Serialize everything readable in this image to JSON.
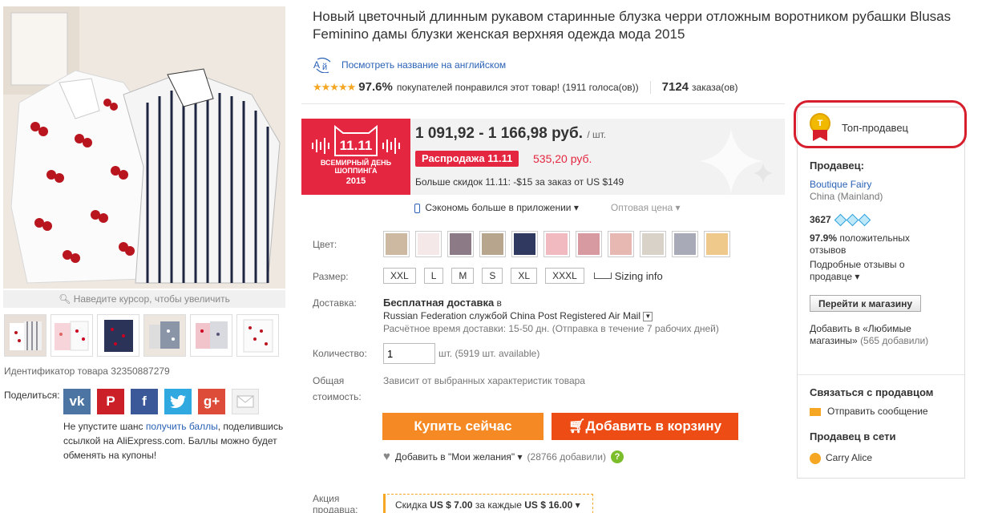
{
  "title": "Новый цветочный длинным рукавом старинные блузка черри отложным воротником рубашки Blusas Feminino дамы блузки женская верхняя одежда мода 2015",
  "translate_link": "Посмотреть название на английском",
  "rating": {
    "percent": "97.6%",
    "text": "покупателей понравился этот товар!",
    "votes": "(1911 голоса(ов))",
    "orders_count": "7124",
    "orders_label": "заказа(ов)"
  },
  "gallery": {
    "zoom_hint": "Наведите курсор, чтобы увеличить",
    "product_id": "Идентификатор товара 32350887279"
  },
  "share": {
    "label": "Поделиться:",
    "text_before": "Не упустите шанс ",
    "link": "получить баллы",
    "text_after": ", поделившись ссылкой на AliExpress.com. Баллы можно будет обменять на купоны!",
    "icons": [
      "vk-icon",
      "pinterest-icon",
      "facebook-icon",
      "twitter-icon",
      "google-plus-icon",
      "email-icon"
    ]
  },
  "banner": {
    "line1": "11.11",
    "line2": "ВСЕМИРНЫЙ ДЕНЬ",
    "line3": "ШОППИНГА",
    "line4": "2015"
  },
  "price": {
    "range": "1 091,92 - 1 166,98 руб.",
    "unit": "/ шт.",
    "sale_tag": "Распродажа 11.11",
    "sale_price": "535,20 руб.",
    "more_discounts": "Больше скидок 11.11: -$15 за заказ от US $149"
  },
  "app_row": {
    "app_text": "Сэкономь больше в приложении",
    "wholesale": "Оптовая цена"
  },
  "labels": {
    "color": "Цвет:",
    "size": "Размер:",
    "shipping": "Доставка:",
    "quantity": "Количество:",
    "total_1": "Общая",
    "total_2": "стоимость:",
    "promo_1": "Акция",
    "promo_2": "продавца:"
  },
  "sizes": [
    "XXL",
    "L",
    "M",
    "S",
    "XL",
    "XXXL"
  ],
  "size_info": "Sizing info",
  "colors": [
    "#cdb8a2",
    "#f4e8e8",
    "#8c7a86",
    "#b7a58e",
    "#303a60",
    "#f1b9c0",
    "#d79aa0",
    "#e7b7b1",
    "#d8d2c8",
    "#a8aab8",
    "#efc98c"
  ],
  "shipping": {
    "free": "Бесплатная доставка",
    "to": "в",
    "method": "Russian Federation службой China Post Registered Air Mail",
    "time": "Расчётное время доставки: 15-50 дн. (Отправка в течение 7 рабочих дней)"
  },
  "quantity": {
    "value": "1",
    "available": "шт. (5919 шт. available)"
  },
  "total_note": "Зависит от выбранных характеристик товара",
  "buttons": {
    "buy": "Купить сейчас",
    "cart": "Добавить в корзину"
  },
  "wishlist": {
    "label": "Добавить в \"Мои желания\"",
    "count": "(28766 добавили)"
  },
  "promo": {
    "text_1": "Скидка ",
    "amount": "US $ 7.00",
    "text_2": " за каждые ",
    "threshold": "US $ 16.00"
  },
  "seller": {
    "top_seller": "Топ-продавец",
    "heading": "Продавец:",
    "name": "Boutique Fairy",
    "location": "China (Mainland)",
    "score": "3627",
    "positive_pct": "97.9%",
    "positive_label": "положительных",
    "positive_label2": "отзывов",
    "details": "Подробные отзывы о",
    "details2": "продавце",
    "store_button": "Перейти к магазину",
    "fav_1": "Добавить в «Любимые",
    "fav_2": "магазины»",
    "fav_count": "(565 добавили)",
    "contact_heading": "Связаться с продавцом",
    "send_message": "Отправить сообщение",
    "online_heading": "Продавец в сети",
    "online_name": "Carry Alice"
  }
}
